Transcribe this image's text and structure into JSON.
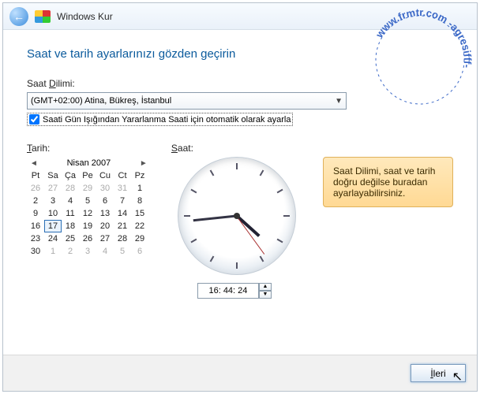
{
  "window": {
    "title": "Windows Kur"
  },
  "heading": "Saat ve tarih ayarlarınızı gözden geçirin",
  "tz": {
    "label_pre": "Saat ",
    "label_under": "D",
    "label_post": "ilimi:",
    "value": "(GMT+02:00) Atina, Bükreş, İstanbul"
  },
  "dst": {
    "checked": true,
    "label": "Saati Gün Işığından Yararlanma Saati için otomatik olarak ayarla"
  },
  "date": {
    "label_under": "T",
    "label_post": "arih:",
    "month": "Nisan 2007",
    "dow": [
      "Pt",
      "Sa",
      "Ça",
      "Pe",
      "Cu",
      "Ct",
      "Pz"
    ],
    "days": [
      {
        "n": "26",
        "oom": true
      },
      {
        "n": "27",
        "oom": true
      },
      {
        "n": "28",
        "oom": true
      },
      {
        "n": "29",
        "oom": true
      },
      {
        "n": "30",
        "oom": true
      },
      {
        "n": "31",
        "oom": true
      },
      {
        "n": "1"
      },
      {
        "n": "2"
      },
      {
        "n": "3"
      },
      {
        "n": "4"
      },
      {
        "n": "5"
      },
      {
        "n": "6"
      },
      {
        "n": "7"
      },
      {
        "n": "8"
      },
      {
        "n": "9"
      },
      {
        "n": "10"
      },
      {
        "n": "11"
      },
      {
        "n": "12"
      },
      {
        "n": "13"
      },
      {
        "n": "14"
      },
      {
        "n": "15"
      },
      {
        "n": "16"
      },
      {
        "n": "17",
        "sel": true
      },
      {
        "n": "18"
      },
      {
        "n": "19"
      },
      {
        "n": "20"
      },
      {
        "n": "21"
      },
      {
        "n": "22"
      },
      {
        "n": "23"
      },
      {
        "n": "24"
      },
      {
        "n": "25"
      },
      {
        "n": "26"
      },
      {
        "n": "27"
      },
      {
        "n": "28"
      },
      {
        "n": "29"
      },
      {
        "n": "30"
      },
      {
        "n": "1",
        "oom": true
      },
      {
        "n": "2",
        "oom": true
      },
      {
        "n": "3",
        "oom": true
      },
      {
        "n": "4",
        "oom": true
      },
      {
        "n": "5",
        "oom": true
      },
      {
        "n": "6",
        "oom": true
      }
    ]
  },
  "clock": {
    "label_under": "S",
    "label_post": "aat:",
    "time": "16: 44: 24"
  },
  "note": "Saat Dilimi, saat ve tarih doğru değilse buradan ayarlayabilirsiniz.",
  "footer": {
    "next_under": "İ",
    "next_post": "leri"
  },
  "watermark": "www.frmtr.com -agresifff-"
}
